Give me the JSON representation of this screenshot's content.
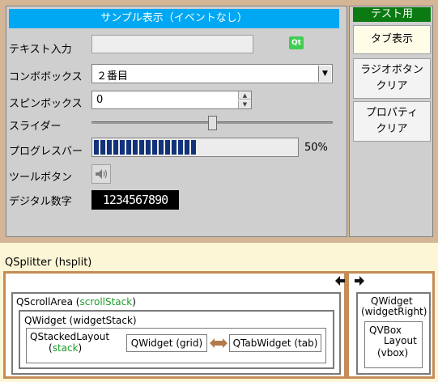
{
  "form": {
    "title": "サンプル表示（イベントなし）",
    "rows": {
      "text_label": "テキスト入力",
      "combo_label": "コンボボックス",
      "spin_label": "スピンボックス",
      "slider_label": "スライダー",
      "progress_label": "プログレスバー",
      "tool_label": "ツールボタン",
      "lcd_label": "デジタル数字"
    },
    "text_input_value": "",
    "qt_logo": "Qt",
    "combo_value": "２番目",
    "spin_value": "0",
    "slider_value": 0.5,
    "progress_value": 50,
    "progress_text": "50%",
    "tool_icon": "speaker-icon",
    "lcd_value": "1234567890"
  },
  "side": {
    "title": "テスト用",
    "buttons": [
      "タブ表示",
      "ラジオボタン\nクリア",
      "プロパティ\nクリア"
    ]
  },
  "diagram": {
    "splitter_label": "QSplitter (hsplit)",
    "scroll_label": "QScrollArea (",
    "scroll_name": "scrollStack",
    "scroll_close": ")",
    "widget_stack_label": "QWidget (widgetStack)",
    "stacked_layout_label": "QStackedLayout",
    "stack_open": "(",
    "stack_name": "stack",
    "stack_close": ")",
    "grid_label": "QWidget (grid)",
    "tab_label": "QTabWidget (tab)",
    "right_widget_line1": "QWidget",
    "right_widget_line2": "(widgetRight)",
    "vbox_line1": "QVBox",
    "vbox_line2": "Layout",
    "vbox_line3": "(vbox)"
  },
  "colors": {
    "title_bar": "#00a7f2",
    "side_title": "#0b7a12",
    "progress": "#12327a",
    "splitter": "#c68b56",
    "highlight_text": "#1c9a2a"
  }
}
